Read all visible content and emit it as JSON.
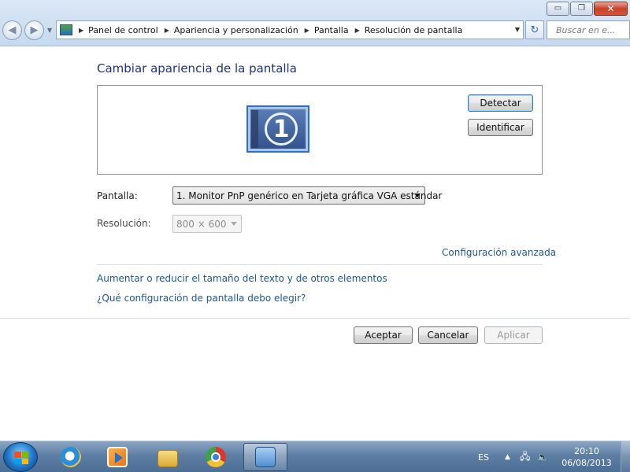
{
  "window": {
    "controls": {
      "minimize": "▭",
      "maximize": "❐",
      "close": "✕"
    }
  },
  "navigation": {
    "back_icon": "◀",
    "forward_icon": "▶",
    "breadcrumbs": [
      {
        "label": "Panel de control"
      },
      {
        "label": "Apariencia y personalización"
      },
      {
        "label": "Pantalla"
      },
      {
        "label": "Resolución de pantalla"
      }
    ],
    "refresh_icon": "↻",
    "search_placeholder": "Buscar en e..."
  },
  "main": {
    "title": "Cambiar apariencia de la pantalla",
    "monitor_number": "1",
    "detect_label": "Detectar",
    "identify_label": "Identificar",
    "display_label": "Pantalla:",
    "display_value": "1. Monitor PnP genérico en Tarjeta gráfica VGA estándar",
    "resolution_label": "Resolución:",
    "resolution_value": "800 × 600",
    "advanced_link": "Configuración avanzada",
    "text_size_link": "Aumentar o reducir el tamaño del texto y de otros elementos",
    "which_settings_link": "¿Qué configuración de pantalla debo elegir?",
    "ok_label": "Aceptar",
    "cancel_label": "Cancelar",
    "apply_label": "Aplicar"
  },
  "taskbar": {
    "items": [
      {
        "name": "internet-explorer",
        "color": "#2a8fd8"
      },
      {
        "name": "media-player",
        "color": "#f08a1e"
      },
      {
        "name": "file-explorer",
        "color": "#e8c25a"
      },
      {
        "name": "chrome",
        "color": "#d9382c"
      },
      {
        "name": "control-panel",
        "color": "#6fa8dc"
      }
    ],
    "language": "ES",
    "time": "20:10",
    "date": "06/08/2013"
  },
  "colors": {
    "title_blue": "#1e3287",
    "link_blue": "#1b5799"
  }
}
